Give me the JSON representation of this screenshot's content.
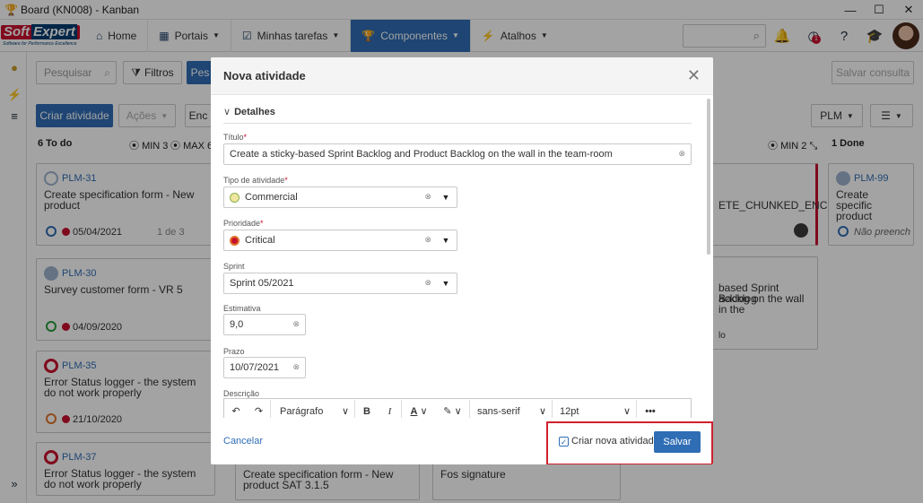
{
  "window": {
    "title": "Board (KN008) - Kanban",
    "controls": [
      "—",
      "☐",
      "✕"
    ]
  },
  "nav": {
    "logo_main": "Soft",
    "logo_accent": "Expert",
    "logo_tagline": "Software for Performance Excellence",
    "items": [
      {
        "label": "Home",
        "icon": "home-icon"
      },
      {
        "label": "Portais",
        "icon": "grid-icon"
      },
      {
        "label": "Minhas tarefas",
        "icon": "tasks-icon"
      },
      {
        "label": "Componentes",
        "icon": "trophy-icon"
      },
      {
        "label": "Atalhos",
        "icon": "bolt-icon"
      }
    ],
    "notification_count": "1"
  },
  "toolbar": {
    "search_placeholder": "Pesquisar",
    "filters": "Filtros",
    "search_btn": "Pes",
    "save_query": "Salvar consulta",
    "create": "Criar atividade",
    "actions": "Ações",
    "enc": "Enc",
    "plm": "PLM"
  },
  "columns": [
    {
      "title": "6 To do",
      "min": "MIN 3",
      "max": "MAX 6"
    },
    {
      "title": "",
      "min": "MIN 2",
      "max": ""
    },
    {
      "title": "1 Done",
      "min": "",
      "max": ""
    }
  ],
  "cards": [
    {
      "id": "PLM-31",
      "title": "Create specification form - New product",
      "date": "05/04/2021",
      "meta": "1 de 3"
    },
    {
      "id": "PLM-30",
      "title": "Survey customer form - VR 5",
      "date": "04/09/2020",
      "meta": ""
    },
    {
      "id": "PLM-35",
      "title": "Error Status logger - the system do not work properly",
      "date": "21/10/2020",
      "meta": ""
    },
    {
      "id": "PLM-37",
      "title": "Error Status logger - the system do not work properly",
      "date": "",
      "meta": ""
    },
    {
      "id": "PLM-99",
      "title": "Create specific product",
      "date": "Não preench",
      "meta": ""
    }
  ],
  "bg_texts": {
    "c2a": "ETE_CHUNKED_ENC",
    "c2b": "based Sprint Backlog",
    "c2c": "acklog on the wall in the",
    "c2d": "lo",
    "c3a": "Create specification form - New",
    "c3b": "product SAT 3.1.5",
    "c4a": "Fos signature"
  },
  "modal": {
    "title": "Nova atividade",
    "section": "Detalhes",
    "fields": {
      "titulo": {
        "label": "Título",
        "value": "Create a sticky-based Sprint Backlog and Product Backlog on the wall in the team-room"
      },
      "tipo": {
        "label": "Tipo de atividade",
        "value": "Commercial"
      },
      "prioridade": {
        "label": "Prioridade",
        "value": "Critical"
      },
      "sprint": {
        "label": "Sprint",
        "value": "Sprint 05/2021"
      },
      "estimativa": {
        "label": "Estimativa",
        "value": "9,0"
      },
      "prazo": {
        "label": "Prazo",
        "value": "10/07/2021"
      },
      "descricao": {
        "label": "Descrição"
      }
    },
    "editor": {
      "paragraph": "Parágrafo",
      "font": "sans-serif",
      "size": "12pt",
      "more": "•••"
    },
    "cancel": "Cancelar",
    "checkbox": "Criar nova atividade",
    "save": "Salvar"
  },
  "colors": {
    "primary": "#2f6db5",
    "danger": "#c8102e",
    "overlay": "rgba(0,0,0,0.36)"
  }
}
